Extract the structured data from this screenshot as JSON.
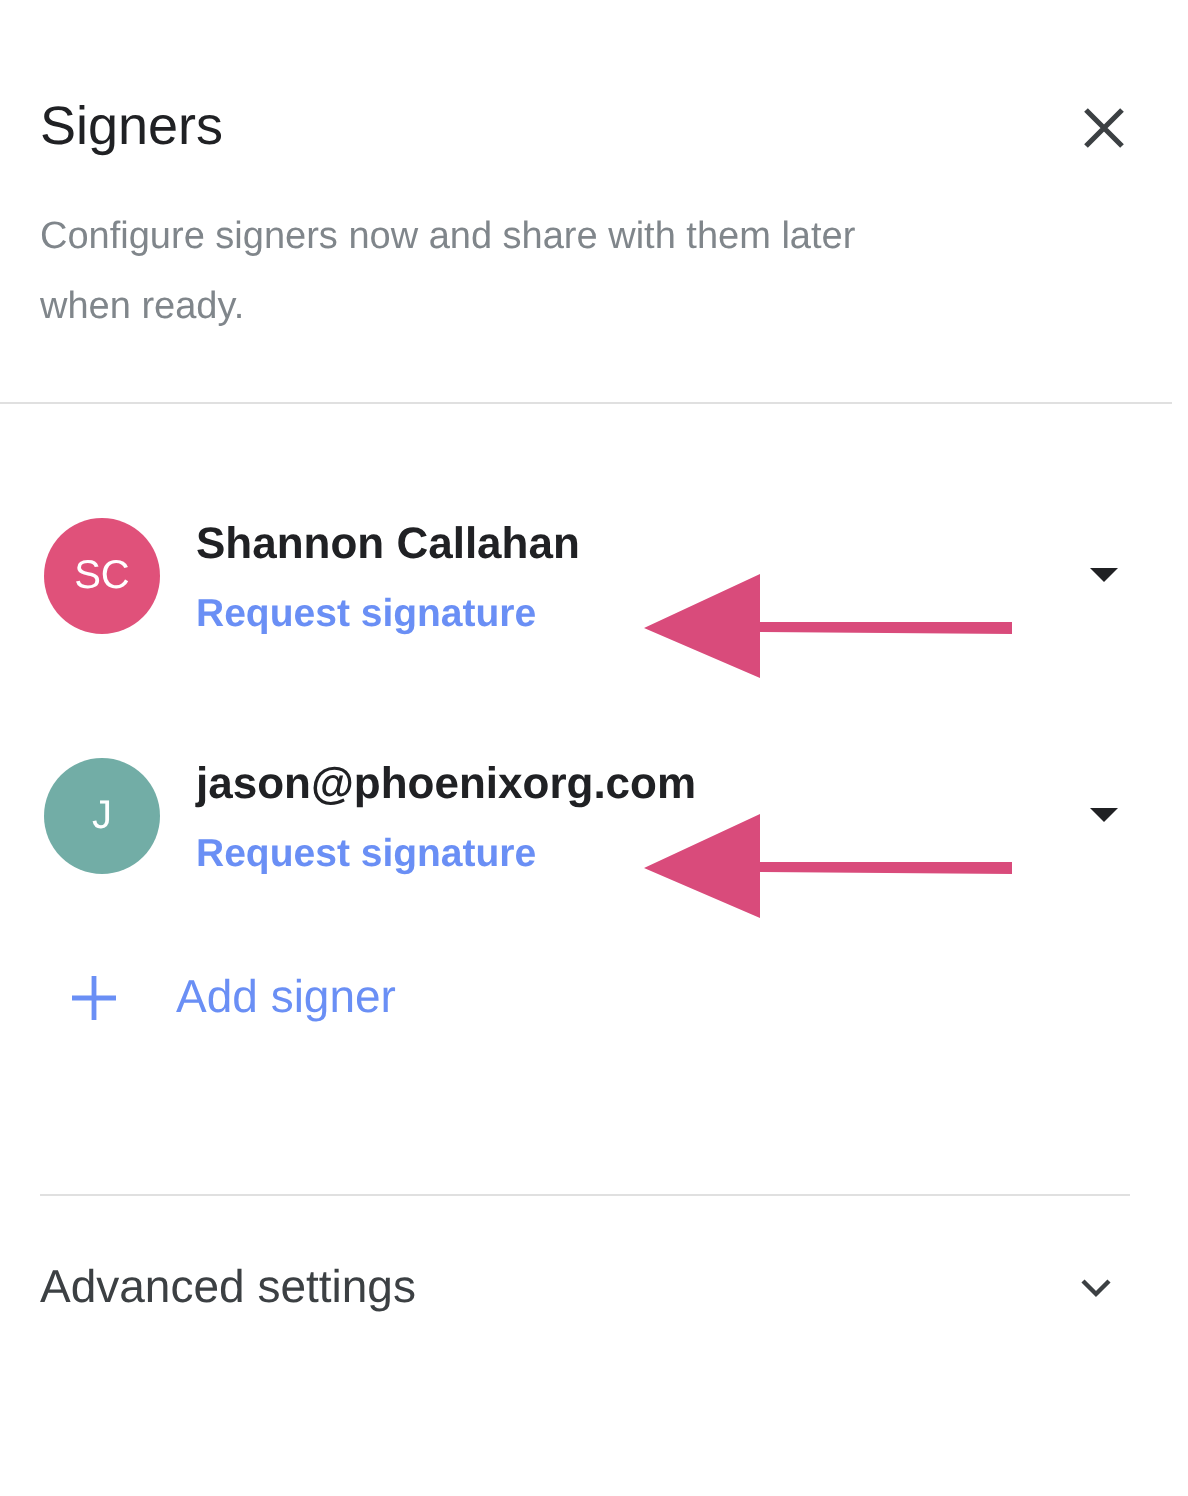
{
  "panel": {
    "title": "Signers",
    "description": "Configure signers now and share with them later when ready."
  },
  "signers": [
    {
      "initials": "SC",
      "name": "Shannon Callahan",
      "action": "Request signature",
      "color": "#e0517a",
      "annotated": true
    },
    {
      "initials": "J",
      "name": "jason@phoenixorg.com",
      "action": "Request signature",
      "color": "#72ada6",
      "annotated": true
    }
  ],
  "add_signer": {
    "label": "Add signer"
  },
  "advanced": {
    "label": "Advanced settings",
    "expanded": false
  }
}
